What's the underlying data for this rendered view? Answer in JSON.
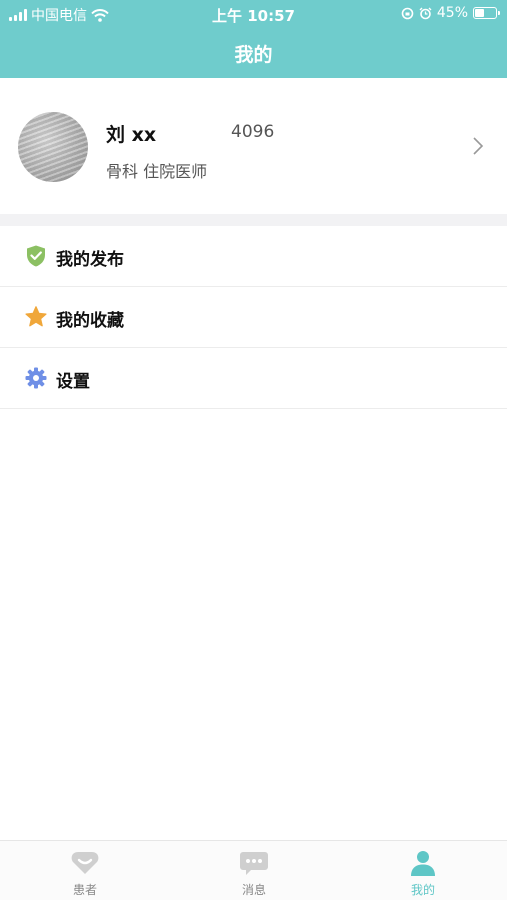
{
  "status_bar": {
    "carrier": "中国电信",
    "time": "上午 10:57",
    "battery_percent": "45%",
    "battery_level": 0.45
  },
  "nav": {
    "title": "我的"
  },
  "profile": {
    "name": "刘 xx",
    "id_number": "4096",
    "department": "骨科  住院医师"
  },
  "menu": [
    {
      "label": "我的发布",
      "icon": "shield-check-icon",
      "color": "#8cc063"
    },
    {
      "label": "我的收藏",
      "icon": "star-icon",
      "color": "#f0a73a"
    },
    {
      "label": "设置",
      "icon": "gear-icon",
      "color": "#6f8fe6"
    }
  ],
  "tabbar": {
    "tabs": [
      {
        "label": "患者",
        "icon": "patients-icon",
        "active": false
      },
      {
        "label": "消息",
        "icon": "message-icon",
        "active": false
      },
      {
        "label": "我的",
        "icon": "profile-icon",
        "active": true
      }
    ]
  },
  "colors": {
    "primary": "#6fcccc",
    "tab_active": "#5ec6c6",
    "tab_inactive": "#cfcfcf"
  }
}
